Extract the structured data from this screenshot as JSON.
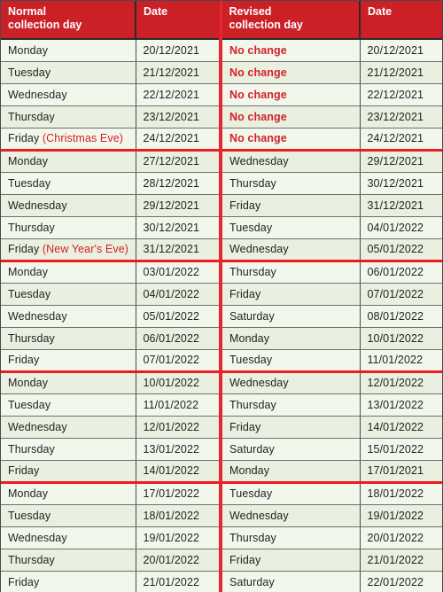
{
  "table": {
    "columns": [
      {
        "id": "normal-collection-day",
        "lines": [
          "Normal",
          "collection day"
        ]
      },
      {
        "id": "normal-date",
        "lines": [
          "Date"
        ]
      },
      {
        "id": "revised-collection-day",
        "lines": [
          "Revised",
          "collection day"
        ]
      },
      {
        "id": "revised-date",
        "lines": [
          "Date"
        ]
      }
    ],
    "header_background": "#cc2027",
    "header_text_color": "#ffffff",
    "accent_red": "#ed1c24",
    "row_tint_a": "#f2f7ec",
    "row_tint_b": "#e9f0e0",
    "rows": [
      {
        "day": "Monday",
        "note": "",
        "date": "20/12/2021",
        "revised_day": "No change",
        "revised_is_red": true,
        "revised_date": "20/12/2021",
        "week_end": false
      },
      {
        "day": "Tuesday",
        "note": "",
        "date": "21/12/2021",
        "revised_day": "No change",
        "revised_is_red": true,
        "revised_date": "21/12/2021",
        "week_end": false
      },
      {
        "day": "Wednesday",
        "note": "",
        "date": "22/12/2021",
        "revised_day": "No change",
        "revised_is_red": true,
        "revised_date": "22/12/2021",
        "week_end": false
      },
      {
        "day": "Thursday",
        "note": "",
        "date": "23/12/2021",
        "revised_day": "No change",
        "revised_is_red": true,
        "revised_date": "23/12/2021",
        "week_end": false
      },
      {
        "day": "Friday",
        "note": "(Christmas Eve)",
        "date": "24/12/2021",
        "revised_day": "No change",
        "revised_is_red": true,
        "revised_date": "24/12/2021",
        "week_end": true
      },
      {
        "day": "Monday",
        "note": "",
        "date": "27/12/2021",
        "revised_day": "Wednesday",
        "revised_is_red": false,
        "revised_date": "29/12/2021",
        "week_end": false
      },
      {
        "day": "Tuesday",
        "note": "",
        "date": "28/12/2021",
        "revised_day": "Thursday",
        "revised_is_red": false,
        "revised_date": "30/12/2021",
        "week_end": false
      },
      {
        "day": "Wednesday",
        "note": "",
        "date": "29/12/2021",
        "revised_day": "Friday",
        "revised_is_red": false,
        "revised_date": "31/12/2021",
        "week_end": false
      },
      {
        "day": "Thursday",
        "note": "",
        "date": "30/12/2021",
        "revised_day": "Tuesday",
        "revised_is_red": false,
        "revised_date": "04/01/2022",
        "week_end": false
      },
      {
        "day": "Friday",
        "note": "(New Year's Eve)",
        "date": "31/12/2021",
        "revised_day": "Wednesday",
        "revised_is_red": false,
        "revised_date": "05/01/2022",
        "week_end": true
      },
      {
        "day": "Monday",
        "note": "",
        "date": "03/01/2022",
        "revised_day": "Thursday",
        "revised_is_red": false,
        "revised_date": "06/01/2022",
        "week_end": false
      },
      {
        "day": "Tuesday",
        "note": "",
        "date": "04/01/2022",
        "revised_day": "Friday",
        "revised_is_red": false,
        "revised_date": "07/01/2022",
        "week_end": false
      },
      {
        "day": "Wednesday",
        "note": "",
        "date": "05/01/2022",
        "revised_day": "Saturday",
        "revised_is_red": false,
        "revised_date": "08/01/2022",
        "week_end": false
      },
      {
        "day": "Thursday",
        "note": "",
        "date": "06/01/2022",
        "revised_day": "Monday",
        "revised_is_red": false,
        "revised_date": "10/01/2022",
        "week_end": false
      },
      {
        "day": "Friday",
        "note": "",
        "date": "07/01/2022",
        "revised_day": "Tuesday",
        "revised_is_red": false,
        "revised_date": "11/01/2022",
        "week_end": true
      },
      {
        "day": "Monday",
        "note": "",
        "date": "10/01/2022",
        "revised_day": "Wednesday",
        "revised_is_red": false,
        "revised_date": "12/01/2022",
        "week_end": false
      },
      {
        "day": "Tuesday",
        "note": "",
        "date": "11/01/2022",
        "revised_day": "Thursday",
        "revised_is_red": false,
        "revised_date": "13/01/2022",
        "week_end": false
      },
      {
        "day": "Wednesday",
        "note": "",
        "date": "12/01/2022",
        "revised_day": "Friday",
        "revised_is_red": false,
        "revised_date": "14/01/2022",
        "week_end": false
      },
      {
        "day": "Thursday",
        "note": "",
        "date": "13/01/2022",
        "revised_day": "Saturday",
        "revised_is_red": false,
        "revised_date": "15/01/2022",
        "week_end": false
      },
      {
        "day": "Friday",
        "note": "",
        "date": "14/01/2022",
        "revised_day": "Monday",
        "revised_is_red": false,
        "revised_date": "17/01/2021",
        "week_end": true
      },
      {
        "day": "Monday",
        "note": "",
        "date": "17/01/2022",
        "revised_day": "Tuesday",
        "revised_is_red": false,
        "revised_date": "18/01/2022",
        "week_end": false
      },
      {
        "day": "Tuesday",
        "note": "",
        "date": "18/01/2022",
        "revised_day": "Wednesday",
        "revised_is_red": false,
        "revised_date": "19/01/2022",
        "week_end": false
      },
      {
        "day": "Wednesday",
        "note": "",
        "date": "19/01/2022",
        "revised_day": "Thursday",
        "revised_is_red": false,
        "revised_date": "20/01/2022",
        "week_end": false
      },
      {
        "day": "Thursday",
        "note": "",
        "date": "20/01/2022",
        "revised_day": "Friday",
        "revised_is_red": false,
        "revised_date": "21/01/2022",
        "week_end": false
      },
      {
        "day": "Friday",
        "note": "",
        "date": "21/01/2022",
        "revised_day": "Saturday",
        "revised_is_red": false,
        "revised_date": "22/01/2022",
        "week_end": false
      }
    ]
  }
}
